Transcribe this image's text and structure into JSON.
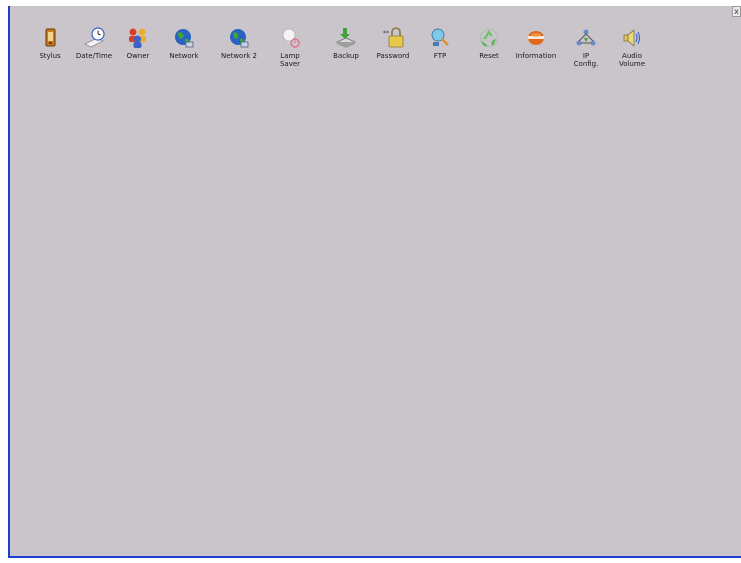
{
  "window": {
    "close_label": "x"
  },
  "control_panel": {
    "items": [
      {
        "label": "Stylus",
        "icon": "stylus-icon"
      },
      {
        "label": "Date/Time",
        "icon": "date-time-icon"
      },
      {
        "label": "Owner",
        "icon": "owner-icon"
      },
      {
        "label": "Network",
        "icon": "network-icon"
      },
      {
        "label": "Network 2",
        "icon": "network-2-icon"
      },
      {
        "label": "Lamp\nSaver",
        "icon": "lamp-saver-icon"
      },
      {
        "label": "Backup",
        "icon": "backup-icon"
      },
      {
        "label": "Password",
        "icon": "password-icon"
      },
      {
        "label": "FTP",
        "icon": "ftp-icon"
      },
      {
        "label": "Reset",
        "icon": "reset-icon"
      },
      {
        "label": "Information",
        "icon": "information-icon"
      },
      {
        "label": "IP\nConfig.",
        "icon": "ip-config-icon"
      },
      {
        "label": "Audio\nVolume",
        "icon": "audio-volume-icon"
      }
    ]
  },
  "colors": {
    "panel_background": "#c9c5cb",
    "panel_border": "#1d3fd0"
  }
}
